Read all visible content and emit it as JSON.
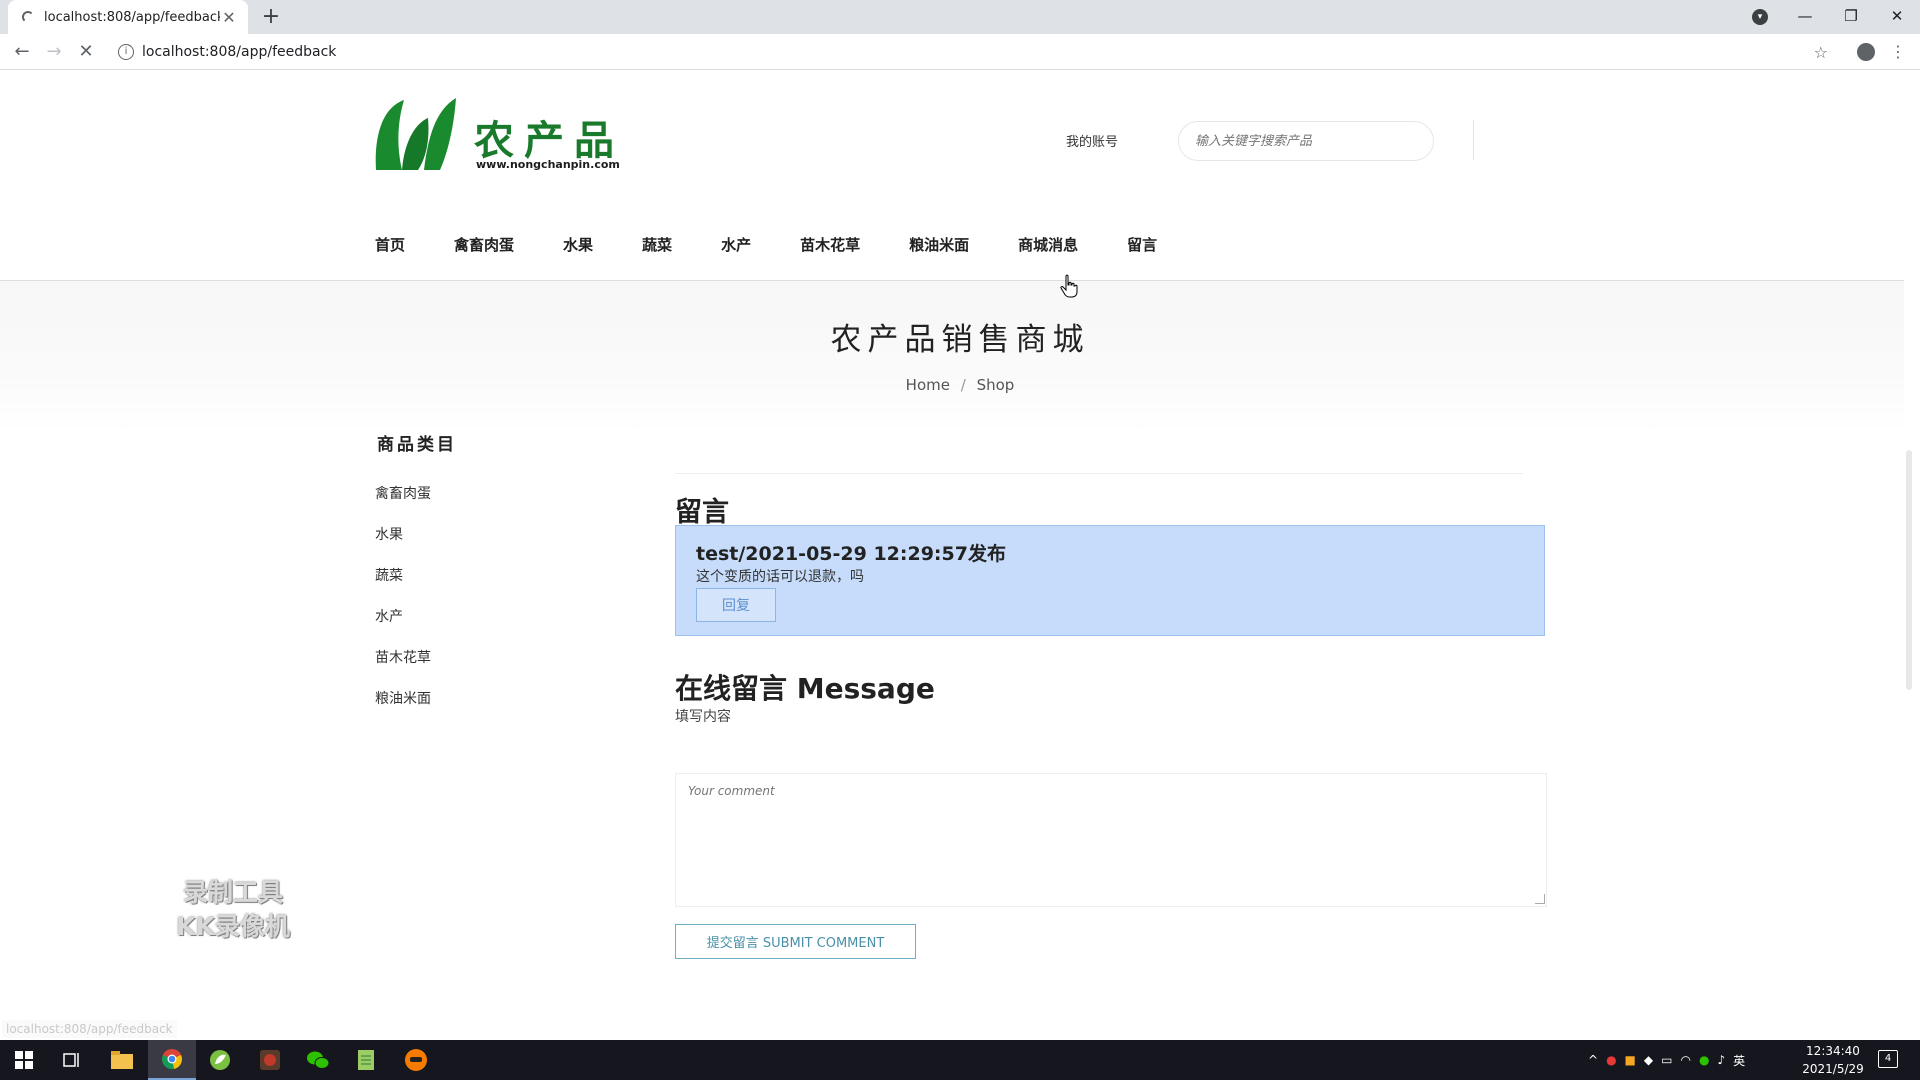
{
  "browser": {
    "tab_title": "localhost:808/app/feedback",
    "url": "localhost:808/app/feedback",
    "status_url": "localhost:808/app/feedback"
  },
  "site": {
    "logo_brand": "农产品",
    "logo_domain": "www.nongchanpin.com",
    "account_link": "我的账号",
    "search_placeholder": "输入关键字搜索产品",
    "nav": [
      "首页",
      "禽畜肉蛋",
      "水果",
      "蔬菜",
      "水产",
      "苗木花草",
      "粮油米面",
      "商城消息",
      "留言"
    ],
    "brand_color": "#1a7a2c"
  },
  "banner": {
    "title": "农产品销售商城",
    "breadcrumb_home": "Home",
    "breadcrumb_sep": "/",
    "breadcrumb_current": "Shop"
  },
  "sidebar": {
    "title": "商品类目",
    "items": [
      "禽畜肉蛋",
      "水果",
      "蔬菜",
      "水产",
      "苗木花草",
      "粮油米面"
    ]
  },
  "feedback": {
    "heading": "留言",
    "entries": [
      {
        "header": "test/2021-05-29 12:29:57发布",
        "body": "这个变质的话可以退款，吗",
        "reply_label": "回复"
      }
    ],
    "card_color": "#c6dcfa"
  },
  "form": {
    "heading": "在线留言 Message",
    "subheading": "填写内容",
    "comment_placeholder": "Your comment",
    "submit_label": "提交留言 SUBMIT COMMENT"
  },
  "overlay": {
    "watermark_line1": "录制工具",
    "watermark_line2": "KK录像机"
  },
  "taskbar": {
    "time": "12:34:40",
    "date": "2021/5/29",
    "ime": "英",
    "notification_count": "4"
  }
}
